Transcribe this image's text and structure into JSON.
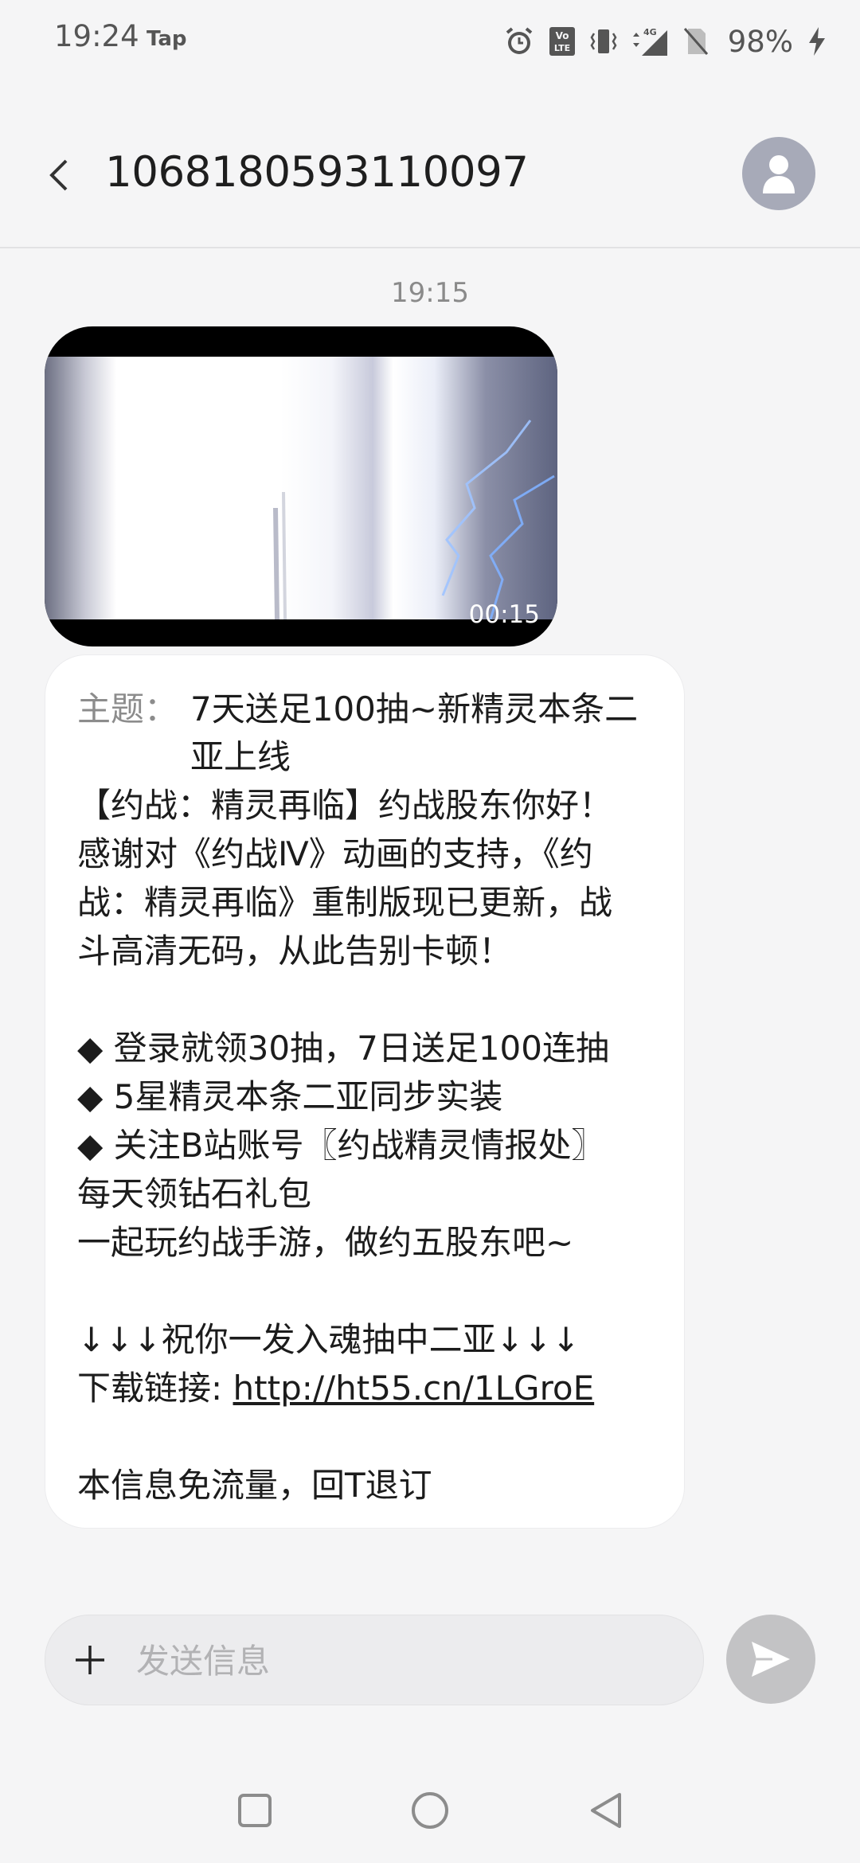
{
  "status_bar": {
    "time": "19:24",
    "app_indicator": "Tap",
    "battery_percent": "98%",
    "icons": [
      "alarm-icon",
      "volte-icon",
      "vibrate-icon",
      "signal-4g-icon",
      "no-sim-icon",
      "charging-icon"
    ]
  },
  "header": {
    "contact": "1068180593110097"
  },
  "thread": {
    "timestamp": "19:15",
    "video": {
      "duration": "00:15"
    },
    "message": {
      "subject_label": "主题：",
      "subject_lines": [
        "7天送足100抽~新精灵本条二",
        "亚上线"
      ],
      "lines": [
        "【约战：精灵再临】约战股东你好！",
        "感谢对《约战Ⅳ》动画的支持，《约",
        "战：精灵再临》重制版现已更新，战",
        "斗高清无码，从此告别卡顿！",
        "",
        "◆ 登录就领30抽，7日送足100连抽",
        "◆ 5星精灵本条二亚同步实装",
        "◆ 关注B站账号〖约战精灵情报处〗",
        "每天领钻石礼包",
        "一起玩约战手游，做约五股东吧~",
        "",
        "↓↓↓祝你一发入魂抽中二亚↓↓↓"
      ],
      "download_label": "下载链接: ",
      "download_link": "http://ht55.cn/1LGroE",
      "footer": "本信息免流量，回T退订"
    }
  },
  "compose": {
    "placeholder": "发送信息"
  },
  "colors": {
    "background": "#f5f5f6",
    "avatar": "#a7aab8",
    "send_button": "#c3c3c5",
    "bubble": "#ffffff"
  }
}
